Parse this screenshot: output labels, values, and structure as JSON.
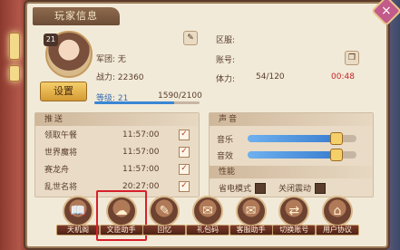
{
  "panel": {
    "title": "玩家信息",
    "close_icon": "×"
  },
  "player": {
    "level_badge": "21",
    "guild_label": "军团: 无",
    "power_label": "战力: 22360",
    "level_label": "等级: 21",
    "exp_text": "1590/2100",
    "exp_fraction": 0.757,
    "zone_label": "区服:",
    "account_label": "账号:",
    "stamina_label": "体力:",
    "stamina_value": "54/120",
    "stamina_timer": "00:48",
    "settings_button": "设置",
    "edit_icon": "✎",
    "copy_icon": "❐"
  },
  "push": {
    "header": "推送",
    "items": [
      {
        "name": "领取午餐",
        "time": "11:57:00",
        "checked": "✓"
      },
      {
        "name": "世界魔将",
        "time": "11:57:00",
        "checked": "✓"
      },
      {
        "name": "赛龙舟",
        "time": "11:57:00",
        "checked": "✓"
      },
      {
        "name": "乱世名将",
        "time": "20:27:00",
        "checked": "✓"
      }
    ]
  },
  "sound": {
    "header": "声音",
    "music_label": "音乐",
    "music_level": 0.82,
    "effect_label": "音效",
    "effect_level": 0.82
  },
  "performance": {
    "header": "性能",
    "power_save_label": "省电模式",
    "vibration_label": "关闭震动"
  },
  "bottom_buttons": [
    {
      "label": "天机阁",
      "icon": "book-icon",
      "glyph": "📖"
    },
    {
      "label": "文臣助手",
      "icon": "helper-icon",
      "glyph": "☁"
    },
    {
      "label": "回忆",
      "icon": "memory-icon",
      "glyph": "✎"
    },
    {
      "label": "礼包码",
      "icon": "gift-code-icon",
      "glyph": "✉"
    },
    {
      "label": "客服助手",
      "icon": "service-icon",
      "glyph": "✉"
    },
    {
      "label": "切换账号",
      "icon": "switch-account-icon",
      "glyph": "⇄"
    },
    {
      "label": "用户协议",
      "icon": "agreement-icon",
      "glyph": "⌂"
    }
  ],
  "colors": {
    "accent_gold": "#f5cf6a",
    "highlight_red": "#d8202a",
    "timer_red": "#c7262a",
    "slider_blue": "#3a7ed0"
  }
}
